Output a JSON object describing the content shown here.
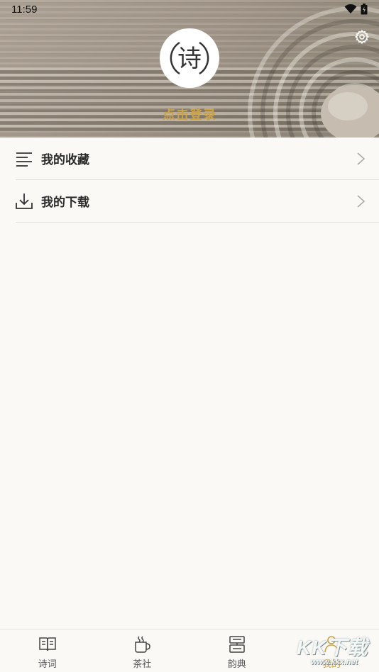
{
  "status_bar": {
    "time": "11:59"
  },
  "profile": {
    "login_label": "点击登录",
    "avatar_glyph": "诗"
  },
  "menu": [
    {
      "label": "我的收藏",
      "icon": "list-icon"
    },
    {
      "label": "我的下载",
      "icon": "download-icon"
    }
  ],
  "bottom_nav": [
    {
      "label": "诗词",
      "icon": "book-icon"
    },
    {
      "label": "茶社",
      "icon": "tea-cup-icon"
    },
    {
      "label": "韵典",
      "icon": "dictionary-icon"
    },
    {
      "label": "我的",
      "icon": "profile-icon",
      "active": true
    }
  ],
  "watermark": {
    "main": "KK下载",
    "sub": "www.kkx.net"
  },
  "colors": {
    "accent": "#c9a24a",
    "background": "#faf9f6"
  }
}
